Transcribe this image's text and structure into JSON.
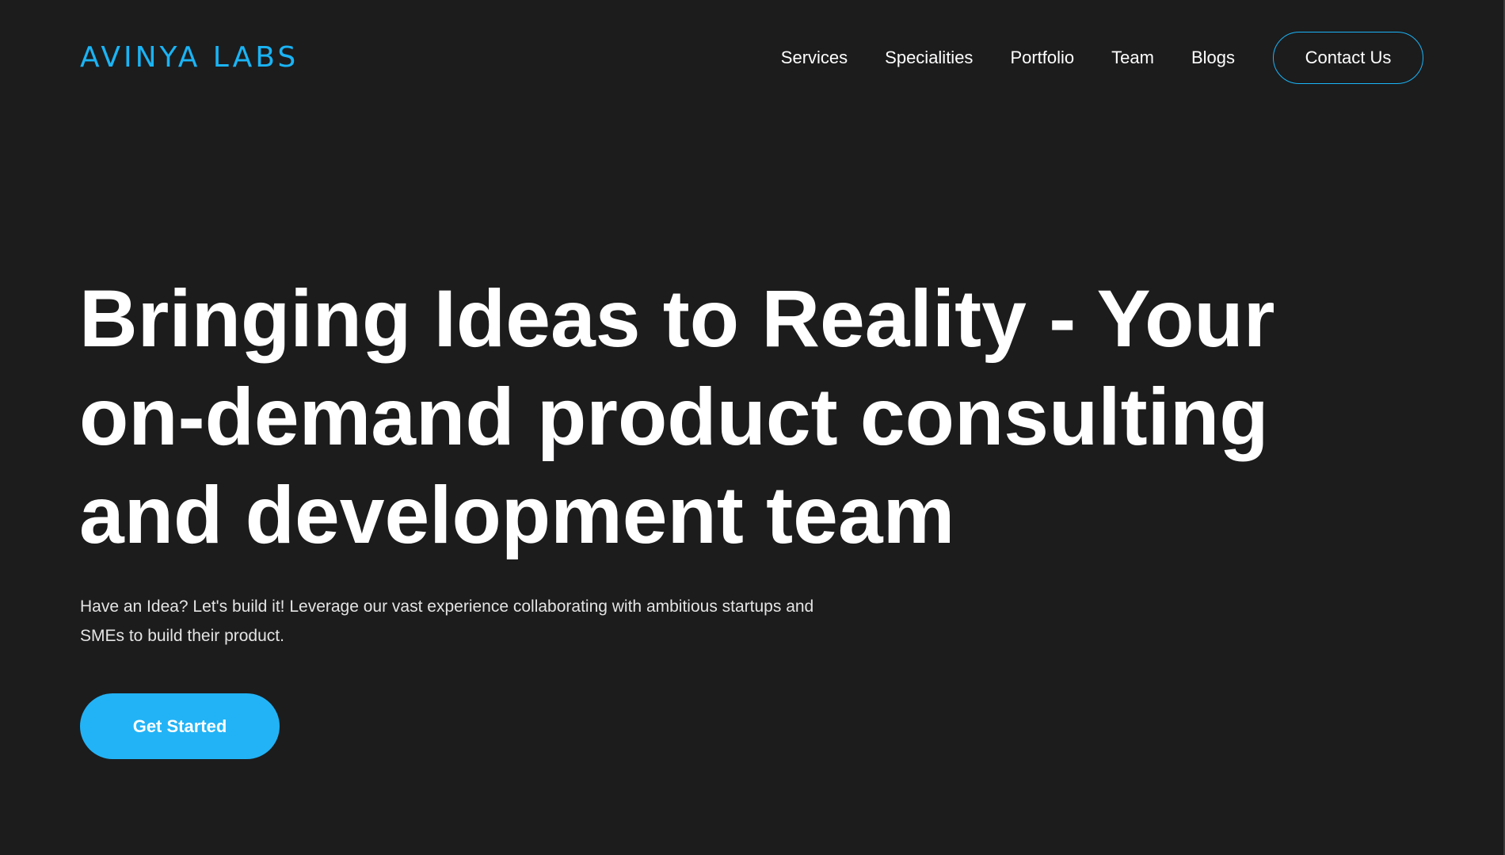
{
  "brand": {
    "logo_text": "AVINYA LABS",
    "accent_color": "#1ab4f5"
  },
  "nav": {
    "items": [
      {
        "label": "Services"
      },
      {
        "label": "Specialities"
      },
      {
        "label": "Portfolio"
      },
      {
        "label": "Team"
      },
      {
        "label": "Blogs"
      }
    ],
    "contact_label": "Contact Us"
  },
  "hero": {
    "title": "Bringing Ideas to Reality - Your on-demand product consulting and development team",
    "subtitle": "Have an Idea? Let's build it! Leverage our vast experience collaborating with ambitious startups and SMEs to build their product.",
    "cta_label": "Get Started",
    "cta_color": "#22b3f6"
  },
  "colors": {
    "background": "#1c1c1d",
    "text": "#ffffff"
  }
}
